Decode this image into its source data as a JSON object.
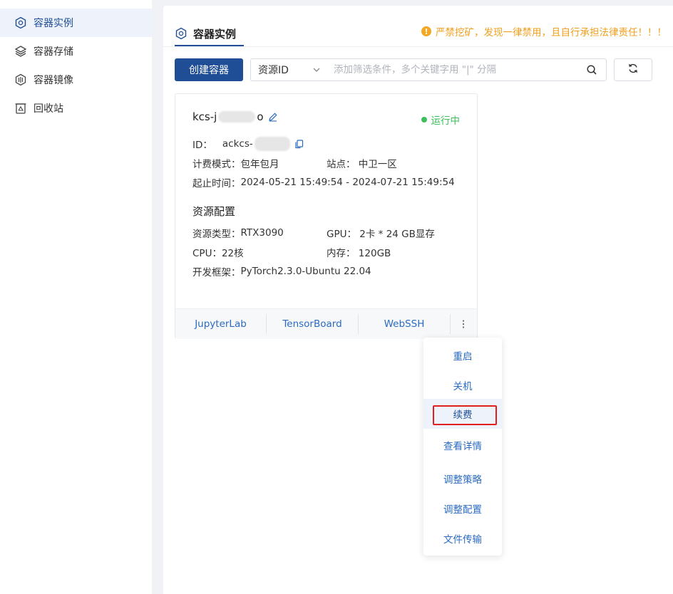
{
  "sidebar": {
    "items": [
      {
        "label": "容器实例",
        "icon": "container-icon",
        "active": true
      },
      {
        "label": "容器存储",
        "icon": "layers-icon",
        "active": false
      },
      {
        "label": "容器镜像",
        "icon": "image-icon",
        "active": false
      },
      {
        "label": "回收站",
        "icon": "recycle-icon",
        "active": false
      }
    ]
  },
  "header": {
    "tab_label": "容器实例",
    "warning": "严禁挖矿，发现一律禁用，且自行承担法律责任！！！",
    "warning_icon": "!"
  },
  "toolbar": {
    "create_label": "创建容器",
    "filter_select": "资源ID",
    "filter_placeholder": "添加筛选条件，多个关键字用 \"|\" 分隔"
  },
  "card": {
    "name_prefix": "kcs-j",
    "name_suffix": "o",
    "status": "运行中",
    "id_label": "ID：",
    "id_prefix": "ackcs-",
    "billing_label": "计费模式：",
    "billing_value": "包年包月",
    "site_label": "站点：",
    "site_value": "中卫一区",
    "period_label": "起止时间：",
    "period_value": "2024-05-21 15:49:54 - 2024-07-21 15:49:54",
    "section_title": "资源配置",
    "resource_type_label": "资源类型：",
    "resource_type_value": "RTX3090",
    "gpu_label": "GPU：",
    "gpu_value": "2卡 * 24 GB显存",
    "cpu_label": "CPU：",
    "cpu_value": "22核",
    "memory_label": "内存：",
    "memory_value": "120GB",
    "framework_label": "开发框架：",
    "framework_value": "PyTorch2.3.0-Ubuntu 22.04",
    "footer_links": [
      "JupyterLab",
      "TensorBoard",
      "WebSSH"
    ]
  },
  "dropdown": {
    "items": [
      "重启",
      "关机",
      "续费",
      "查看详情",
      "调整策略",
      "调整配置",
      "文件传输"
    ]
  },
  "colors": {
    "primary": "#1f4e96",
    "link": "#2a6bc2",
    "warning": "#f0a020",
    "running": "#3cc05a",
    "highlight_border": "#e02020"
  }
}
